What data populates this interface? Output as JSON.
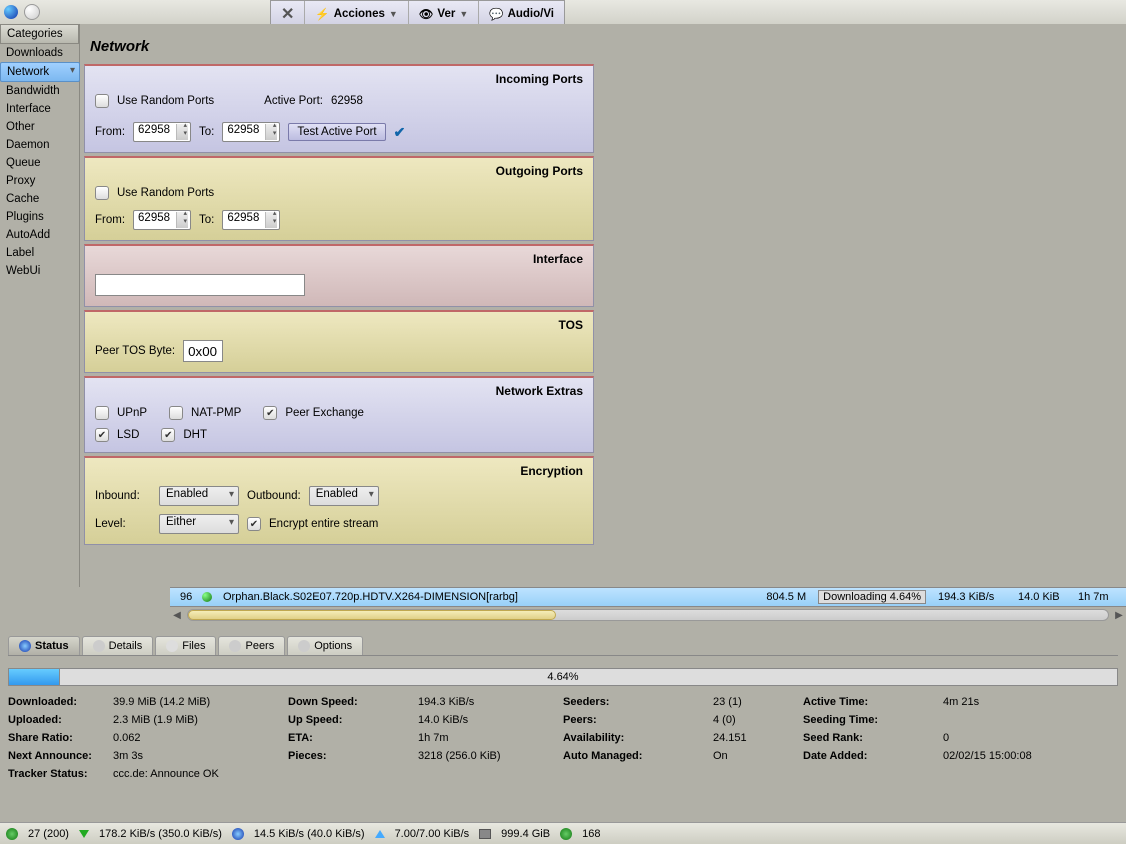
{
  "toolbar": {
    "acciones": "Acciones",
    "ver": "Ver",
    "audio": "Audio/Vi"
  },
  "sidebar": {
    "header": "Categories",
    "items": [
      "Downloads",
      "Network",
      "Bandwidth",
      "Interface",
      "Other",
      "Daemon",
      "Queue",
      "Proxy",
      "Cache",
      "Plugins",
      "AutoAdd",
      "Label",
      "WebUi"
    ],
    "selected": 1
  },
  "page": {
    "title": "Network"
  },
  "incoming": {
    "title": "Incoming Ports",
    "random_label": "Use Random Ports",
    "random": false,
    "active_port_lbl": "Active Port:",
    "active_port": "62958",
    "from_lbl": "From:",
    "from": "62958",
    "to_lbl": "To:",
    "to": "62958",
    "test_btn": "Test Active Port"
  },
  "outgoing": {
    "title": "Outgoing Ports",
    "random_label": "Use Random Ports",
    "random": false,
    "from_lbl": "From:",
    "from": "62958",
    "to_lbl": "To:",
    "to": "62958"
  },
  "interface": {
    "title": "Interface",
    "value": ""
  },
  "tos": {
    "title": "TOS",
    "peer_lbl": "Peer TOS Byte:",
    "value": "0x00"
  },
  "extras": {
    "title": "Network Extras",
    "upnp": "UPnP",
    "upnp_on": false,
    "natpmp": "NAT-PMP",
    "natpmp_on": false,
    "peerex": "Peer Exchange",
    "peerex_on": true,
    "lsd": "LSD",
    "lsd_on": true,
    "dht": "DHT",
    "dht_on": true
  },
  "encryption": {
    "title": "Encryption",
    "inbound_lbl": "Inbound:",
    "inbound": "Enabled",
    "outbound_lbl": "Outbound:",
    "outbound": "Enabled",
    "level_lbl": "Level:",
    "level": "Either",
    "entire_lbl": "Encrypt entire stream",
    "entire_on": true
  },
  "torrent": {
    "num": "96",
    "name": "Orphan.Black.S02E07.720p.HDTV.X264-DIMENSION[rarbg]",
    "size": "804.5 M",
    "progress": "Downloading 4.64%",
    "dl": "194.3 KiB/s",
    "ul": "14.0 KiB",
    "eta": "1h 7m"
  },
  "tabs": {
    "status": "Status",
    "details": "Details",
    "files": "Files",
    "peers": "Peers",
    "options": "Options"
  },
  "stats": {
    "pct": "4.64%",
    "pct_val": 4.64,
    "downloaded_k": "Downloaded:",
    "downloaded_v": "39.9 MiB (14.2 MiB)",
    "uploaded_k": "Uploaded:",
    "uploaded_v": "2.3 MiB (1.9 MiB)",
    "ratio_k": "Share Ratio:",
    "ratio_v": "0.062",
    "next_k": "Next Announce:",
    "next_v": "3m 3s",
    "tracker_k": "Tracker Status:",
    "tracker_v": "ccc.de: Announce OK",
    "downspeed_k": "Down Speed:",
    "downspeed_v": "194.3 KiB/s",
    "upspeed_k": "Up Speed:",
    "upspeed_v": "14.0 KiB/s",
    "eta_k": "ETA:",
    "eta_v": "1h 7m",
    "pieces_k": "Pieces:",
    "pieces_v": "3218 (256.0 KiB)",
    "seeders_k": "Seeders:",
    "seeders_v": "23 (1)",
    "peers_k": "Peers:",
    "peers_v": "4 (0)",
    "avail_k": "Availability:",
    "avail_v": "24.151",
    "auto_k": "Auto Managed:",
    "auto_v": "On",
    "active_k": "Active Time:",
    "active_v": "4m 21s",
    "seeding_k": "Seeding Time:",
    "seeding_v": "",
    "seedrank_k": "Seed Rank:",
    "seedrank_v": "0",
    "added_k": "Date Added:",
    "added_v": "02/02/15 15:00:08"
  },
  "statusbar": {
    "conn": "27 (200)",
    "dl": "178.2 KiB/s (350.0 KiB/s)",
    "ul": "14.5 KiB/s (40.0 KiB/s)",
    "proto": "7.00/7.00 KiB/s",
    "disk": "999.4 GiB",
    "dht": "168"
  }
}
